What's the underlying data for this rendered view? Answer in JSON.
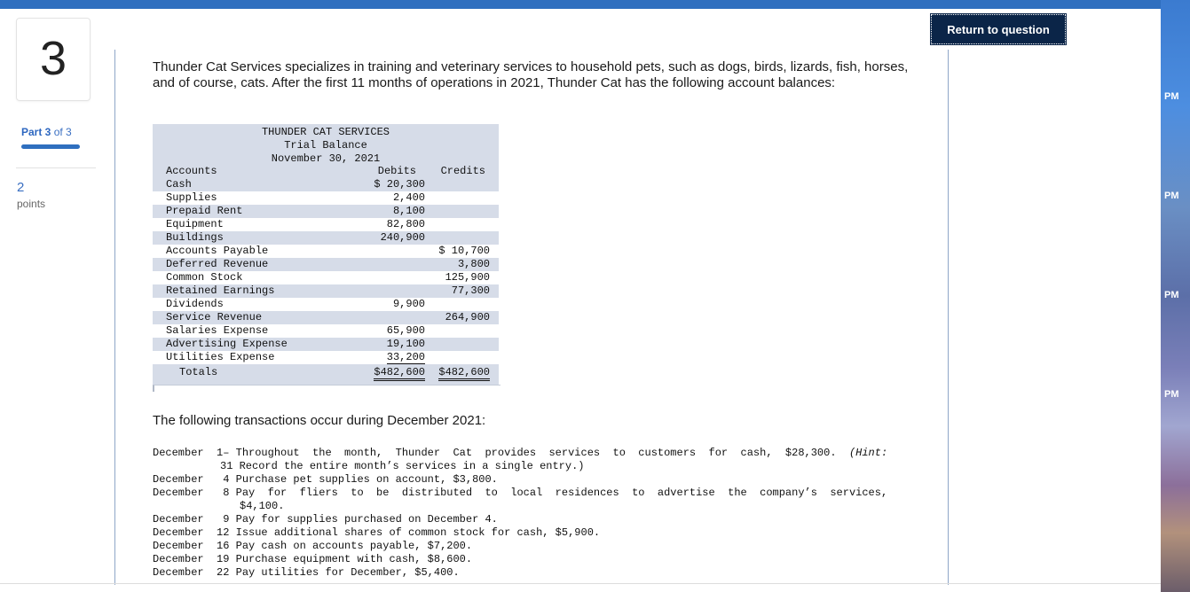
{
  "question": {
    "number": "3",
    "part_label": "Part 3",
    "part_of": "of 3",
    "points_value": "2",
    "points_label": "points",
    "return_button": "Return to question",
    "intro": "Thunder Cat Services specializes in training and veterinary services to household pets, such as dogs, birds, lizards, fish, horses, and of course, cats. After the first 11 months of operations in 2021, Thunder Cat has the following account balances:",
    "transactions_heading": "The following transactions occur during December 2021:"
  },
  "trial_balance": {
    "company": "THUNDER CAT SERVICES",
    "title": "Trial Balance",
    "date": "November 30, 2021",
    "col_accounts": "Accounts",
    "col_debits": "Debits",
    "col_credits": "Credits",
    "rows": [
      {
        "account": "Cash",
        "debit": "$ 20,300",
        "credit": ""
      },
      {
        "account": "Supplies",
        "debit": "2,400",
        "credit": ""
      },
      {
        "account": "Prepaid Rent",
        "debit": "8,100",
        "credit": ""
      },
      {
        "account": "Equipment",
        "debit": "82,800",
        "credit": ""
      },
      {
        "account": "Buildings",
        "debit": "240,900",
        "credit": ""
      },
      {
        "account": "Accounts Payable",
        "debit": "",
        "credit": "$ 10,700"
      },
      {
        "account": "Deferred Revenue",
        "debit": "",
        "credit": "3,800"
      },
      {
        "account": "Common Stock",
        "debit": "",
        "credit": "125,900"
      },
      {
        "account": "Retained Earnings",
        "debit": "",
        "credit": "77,300"
      },
      {
        "account": "Dividends",
        "debit": "9,900",
        "credit": ""
      },
      {
        "account": "Service Revenue",
        "debit": "",
        "credit": "264,900"
      },
      {
        "account": "Salaries Expense",
        "debit": "65,900",
        "credit": ""
      },
      {
        "account": "Advertising Expense",
        "debit": "19,100",
        "credit": ""
      },
      {
        "account": "Utilities Expense",
        "debit": "33,200",
        "credit": ""
      }
    ],
    "totals_label": "Totals",
    "total_debit": "$482,600",
    "total_credit": "$482,600"
  },
  "transactions": [
    {
      "month": "December",
      "day": "1–",
      "text": "Throughout  the  month,  Thunder  Cat  provides  services  to  customers  for  cash,  $28,300.  ",
      "hint": "(Hint:"
    },
    {
      "month": "",
      "day": "31",
      "text": "Record the entire month’s services in a single entry.)",
      "hint": ""
    },
    {
      "month": "December",
      "day": "4",
      "text": "Purchase pet supplies on account, $3,800.",
      "hint": ""
    },
    {
      "month": "December",
      "day": "8",
      "text": "Pay  for  fliers  to  be  distributed  to  local  residences  to  advertise  the  company’s  services,",
      "hint": ""
    },
    {
      "month": "",
      "day": "",
      "text": "$4,100.",
      "hint": ""
    },
    {
      "month": "December",
      "day": "9",
      "text": "Pay for supplies purchased on December 4.",
      "hint": ""
    },
    {
      "month": "December",
      "day": "12",
      "text": "Issue additional shares of common stock for cash, $5,900.",
      "hint": ""
    },
    {
      "month": "December",
      "day": "16",
      "text": "Pay cash on accounts payable, $7,200.",
      "hint": ""
    },
    {
      "month": "December",
      "day": "19",
      "text": "Purchase equipment with cash, $8,600.",
      "hint": ""
    },
    {
      "month": "December",
      "day": "22",
      "text": "Pay utilities for December, $5,400.",
      "hint": ""
    }
  ],
  "desktop_times": [
    "PM",
    "PM",
    "PM",
    "PM"
  ]
}
